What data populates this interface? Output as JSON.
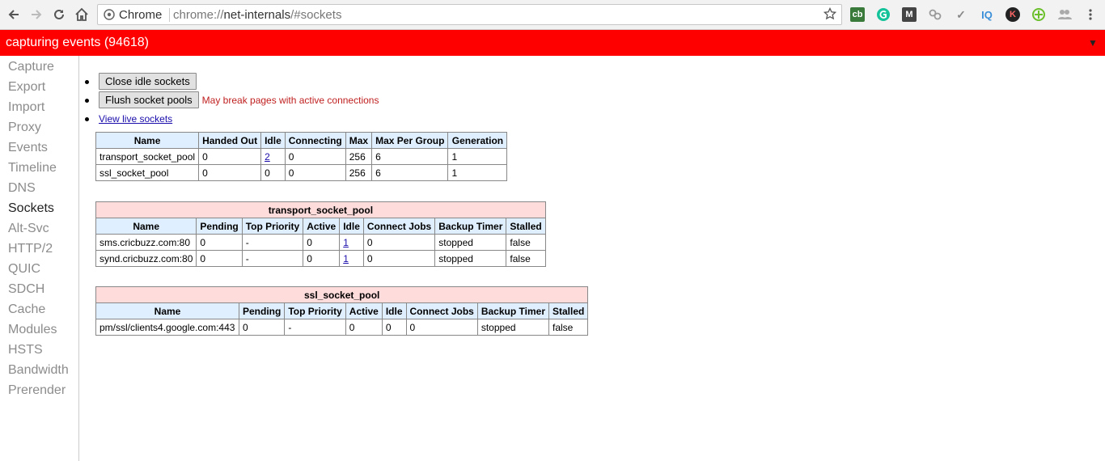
{
  "browser": {
    "site_label": "Chrome",
    "url_prefix": "chrome://",
    "url_host": "net-internals",
    "url_path": "/#sockets"
  },
  "status": {
    "text": "capturing events (94618)"
  },
  "sidebar": {
    "items": [
      {
        "label": "Capture"
      },
      {
        "label": "Export"
      },
      {
        "label": "Import"
      },
      {
        "label": "Proxy"
      },
      {
        "label": "Events"
      },
      {
        "label": "Timeline"
      },
      {
        "label": "DNS"
      },
      {
        "label": "Sockets",
        "active": true
      },
      {
        "label": "Alt-Svc"
      },
      {
        "label": "HTTP/2"
      },
      {
        "label": "QUIC"
      },
      {
        "label": "SDCH"
      },
      {
        "label": "Cache"
      },
      {
        "label": "Modules"
      },
      {
        "label": "HSTS"
      },
      {
        "label": "Bandwidth"
      },
      {
        "label": "Prerender"
      }
    ]
  },
  "actions": {
    "close_idle_label": "Close idle sockets",
    "flush_label": "Flush socket pools",
    "flush_warning": "May break pages with active connections",
    "view_live_label": "View live sockets"
  },
  "summary_table": {
    "headers": [
      "Name",
      "Handed Out",
      "Idle",
      "Connecting",
      "Max",
      "Max Per Group",
      "Generation"
    ],
    "rows": [
      [
        "transport_socket_pool",
        "0",
        "2",
        "0",
        "256",
        "6",
        "1"
      ],
      [
        "ssl_socket_pool",
        "0",
        "0",
        "0",
        "256",
        "6",
        "1"
      ]
    ]
  },
  "transport_table": {
    "caption": "transport_socket_pool",
    "headers": [
      "Name",
      "Pending",
      "Top Priority",
      "Active",
      "Idle",
      "Connect Jobs",
      "Backup Timer",
      "Stalled"
    ],
    "rows": [
      [
        "sms.cricbuzz.com:80",
        "0",
        "-",
        "0",
        "1",
        "0",
        "stopped",
        "false"
      ],
      [
        "synd.cricbuzz.com:80",
        "0",
        "-",
        "0",
        "1",
        "0",
        "stopped",
        "false"
      ]
    ]
  },
  "ssl_table": {
    "caption": "ssl_socket_pool",
    "headers": [
      "Name",
      "Pending",
      "Top Priority",
      "Active",
      "Idle",
      "Connect Jobs",
      "Backup Timer",
      "Stalled"
    ],
    "rows": [
      [
        "pm/ssl/clients4.google.com:443",
        "0",
        "-",
        "0",
        "0",
        "0",
        "stopped",
        "false"
      ]
    ]
  },
  "extensions": [
    {
      "icon": "clipboard-extension-icon",
      "color": "#3a7a3a"
    },
    {
      "icon": "grammarly-icon",
      "color": "#15c39a"
    },
    {
      "icon": "gmail-m-icon",
      "color": "#444444"
    },
    {
      "icon": "link-chain-icon",
      "color": "#999999"
    },
    {
      "icon": "checkmark-icon",
      "color": "#888888"
    },
    {
      "icon": "iq-icon",
      "color": "#3a8fd8"
    },
    {
      "icon": "k-icon",
      "color": "#222222"
    },
    {
      "icon": "crosshair-plus-icon",
      "color": "#6abf2a"
    },
    {
      "icon": "people-icon",
      "color": "#aaaaaa"
    }
  ]
}
